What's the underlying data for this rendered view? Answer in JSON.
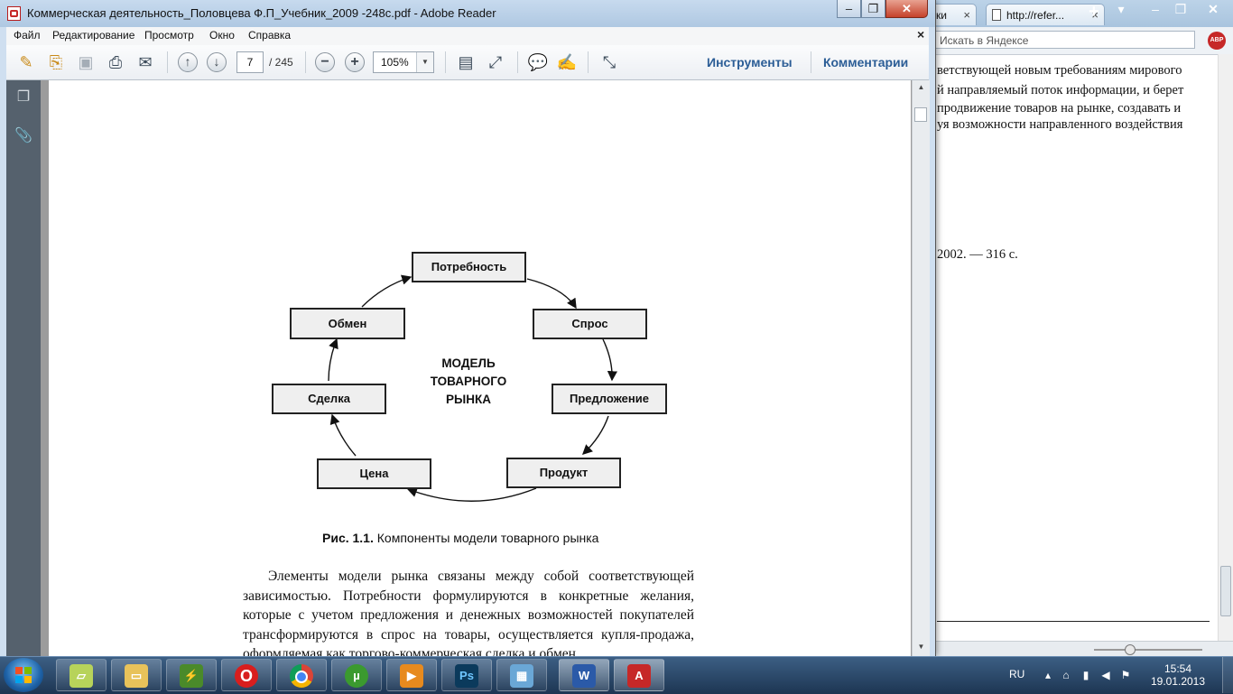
{
  "browser": {
    "tab1_label": "ки",
    "tab2_label": "http://refer...",
    "search_placeholder": "Искать в Яндексе",
    "abp_label": "ABP",
    "text_lines": [
      "ветствующей новым требованиям мирового",
      "й направляемый поток информации, и берет",
      "продвижение товаров на рынке, создавать и",
      "уя возможности направленного воздействия"
    ],
    "ref_line": "2002. — 316 с."
  },
  "reader": {
    "title": "Коммерческая деятельность_Половцева Ф.П_Учебник_2009 -248с.pdf - Adobe Reader",
    "menu": [
      "Файл",
      "Редактирование",
      "Просмотр",
      "Окно",
      "Справка"
    ],
    "page_current": "7",
    "page_total": "/ 245",
    "zoom": "105%",
    "tools_label": "Инструменты",
    "comments_label": "Комментарии"
  },
  "document": {
    "diagram": {
      "nodes": [
        "Потребность",
        "Спрос",
        "Предложение",
        "Продукт",
        "Цена",
        "Сделка",
        "Обмен"
      ],
      "center_label": "МОДЕЛЬ\nТОВАРНОГО\nРЫНКА"
    },
    "caption_prefix": "Рис. 1.1.",
    "caption_text": " Компоненты модели товарного рынка",
    "paragraph": "Элементы модели рынка связаны между собой соответствующей зависимостью. Потребности формулируются в конкретные желания, которые с учетом предложения и денежных возможностей покупателей трансформируются в спрос на товары, осуществляется купля-продажа, оформляемая как торгово-коммерческая сделка и обмен"
  },
  "taskbar": {
    "language": "RU",
    "time": "15:54",
    "date": "19.01.2013",
    "apps": [
      "file-manager",
      "explorer",
      "winamp",
      "opera",
      "chrome",
      "utorrent",
      "media-player",
      "photoshop",
      "image-viewer",
      "word",
      "adobe-reader"
    ]
  }
}
